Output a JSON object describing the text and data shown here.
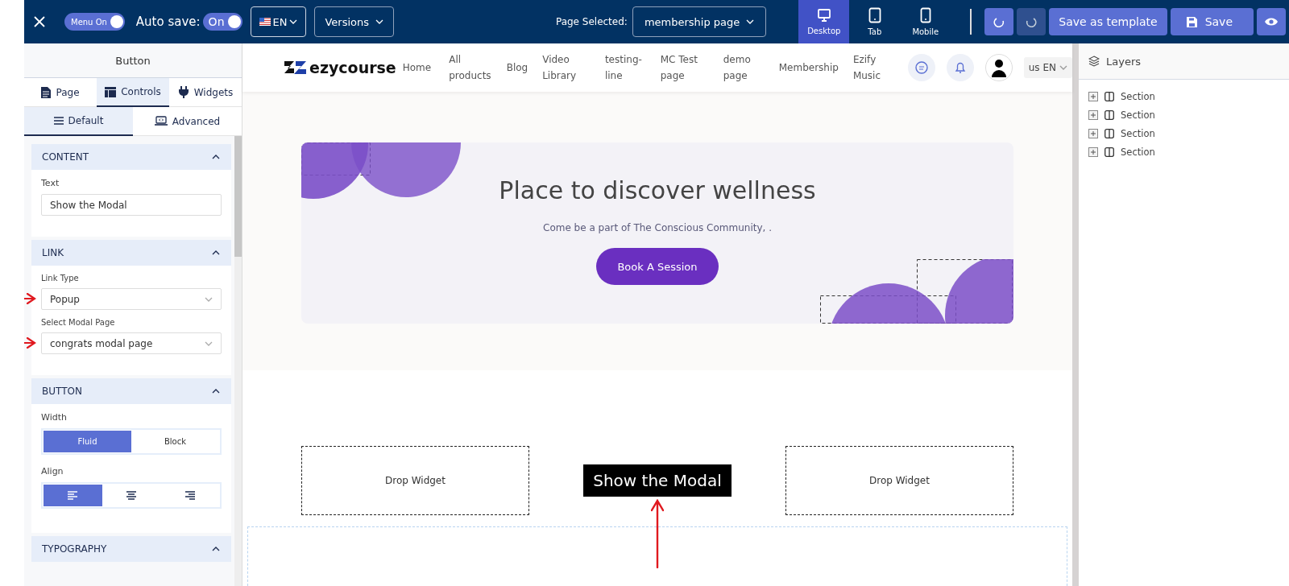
{
  "topbar": {
    "menu_toggle": {
      "label": "Menu On",
      "on": true
    },
    "autosave": {
      "label": "Auto save:",
      "toggle_label": "On",
      "on": true
    },
    "language": "EN",
    "versions": "Versions",
    "page_selected": {
      "label": "Page Selected:",
      "value": "membership page"
    },
    "devices": [
      {
        "kind": "desktop",
        "label": "Desktop",
        "selected": true
      },
      {
        "kind": "tab",
        "label": "Tab",
        "selected": false
      },
      {
        "kind": "mobile",
        "label": "Mobile",
        "selected": false
      }
    ],
    "actions": [
      {
        "kind": "undo",
        "disabled": false
      },
      {
        "kind": "redo",
        "disabled": true
      },
      {
        "kind": "template",
        "label": "Save as template"
      },
      {
        "kind": "save",
        "label": "Save"
      },
      {
        "kind": "preview"
      }
    ]
  },
  "left_panel": {
    "title": "Button",
    "tabs": [
      {
        "kind": "page",
        "label": "Page",
        "selected": false
      },
      {
        "kind": "controls",
        "label": "Controls",
        "selected": true
      },
      {
        "kind": "widgets",
        "label": "Widgets",
        "selected": false
      }
    ],
    "subtabs": [
      {
        "kind": "default",
        "label": "Default",
        "selected": true
      },
      {
        "kind": "advanced",
        "label": "Advanced",
        "selected": false
      }
    ],
    "sections": [
      {
        "title": "CONTENT",
        "expanded": true,
        "fields": [
          {
            "kind": "text",
            "label": "Text",
            "value": "Show the Modal"
          }
        ]
      },
      {
        "title": "LINK",
        "expanded": true,
        "fields": [
          {
            "kind": "select",
            "label": "Link Type",
            "value": "Popup",
            "marked": true
          },
          {
            "kind": "select",
            "label": "Select Modal Page",
            "value": "congrats modal page",
            "marked": true
          }
        ]
      },
      {
        "title": "BUTTON",
        "expanded": true,
        "fields": [
          {
            "kind": "segmented",
            "label": "Width",
            "options": [
              {
                "label": "Fluid",
                "selected": true
              },
              {
                "label": "Block",
                "selected": false
              }
            ]
          },
          {
            "kind": "align",
            "label": "Align",
            "options": [
              {
                "kind": "left",
                "selected": true
              },
              {
                "kind": "center",
                "selected": false
              },
              {
                "kind": "right",
                "selected": false
              }
            ]
          }
        ]
      },
      {
        "title": "TYPOGRAPHY",
        "expanded": true
      }
    ]
  },
  "canvas": {
    "nav": {
      "logo": "ezycourse",
      "links": [
        "Home",
        "All products",
        "Blog",
        "Video Library",
        "testing-line",
        "MC Test page",
        "demo page",
        "Membership",
        "Ezify Music"
      ],
      "language": "us EN"
    },
    "hero": {
      "title": "Place to discover wellness",
      "subtitle": "Come be a part of The Conscious Community, .",
      "button": "Book A Session"
    },
    "widgets": [
      {
        "kind": "drop",
        "label": "Drop Widget"
      },
      {
        "kind": "button",
        "label": "Show the Modal",
        "marked": true
      },
      {
        "kind": "drop",
        "label": "Drop Widget"
      }
    ]
  },
  "layers": {
    "title": "Layers",
    "items": [
      {
        "label": "Section",
        "expanded": false
      },
      {
        "label": "Section",
        "expanded": false
      },
      {
        "label": "Section",
        "expanded": false
      },
      {
        "label": "Section",
        "expanded": false
      }
    ]
  }
}
